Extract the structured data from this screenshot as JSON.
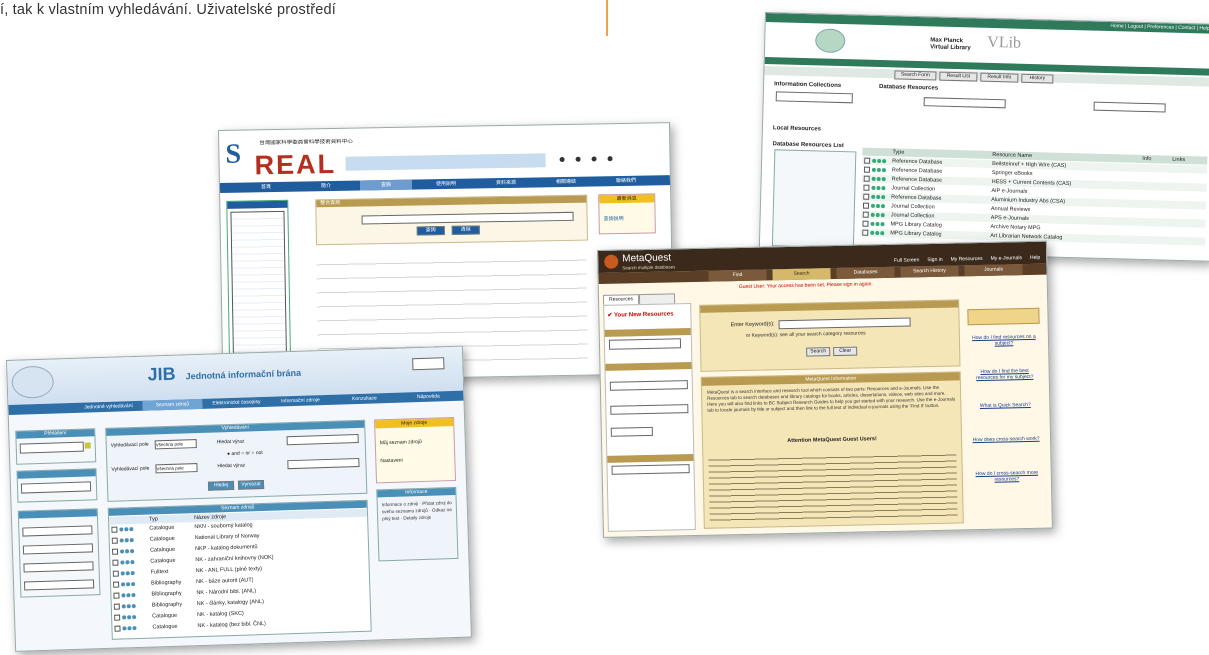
{
  "intro_text": "í, tak k vlastním vyhledávání. Uživatelské prostředí",
  "colors": {
    "accent_line": "#f0a050",
    "vlib_green": "#2e7a5a",
    "real_blue": "#1f5d9e",
    "metaquest_dark": "#3b2a1c",
    "metaquest_tan": "#f5e6b8",
    "jib_blue": "#2f6fa8"
  },
  "vlib": {
    "brand": "Max Planck Virtual Library",
    "logo_text": "VLib",
    "top_links": "Home | Logout | Preferences | Contact | Help",
    "search_tabs": [
      "Search Form",
      "Result List",
      "Result Info",
      "History"
    ],
    "sections": [
      "Information Collections",
      "Database Resources",
      "Local Resources",
      "Database Resources List"
    ],
    "list_header": [
      "Type",
      "Resource Name",
      "Info",
      "Links"
    ],
    "types": [
      "Reference Database",
      "Reference Database",
      "Reference Database",
      "Journal Collection",
      "Reference Database",
      "Journal Collection",
      "Journal Collection",
      "MPG Library Catalog",
      "MPG Library Catalog"
    ],
    "names": [
      "Beilsteinref + High Wire (CAS)",
      "Springer eBooks",
      "HESS + Current Contents (CAS)",
      "AIP e-Journals",
      "Aluminium Industry Abs (CSA)",
      "Annual Reviews",
      "APS e-Journals",
      "Archive Notary MPG",
      "Art Librarian Network Catalog"
    ]
  },
  "real": {
    "logo_text": "REAL",
    "logo_mark": "S",
    "logo_subtitle": "台灣國家科學委員會科學技術資料中心",
    "nav": [
      "首頁",
      "簡介",
      "查詢",
      "使用說明",
      "資料來源",
      "相關連結",
      "聯絡我們"
    ],
    "search_box_title": "整合查詢",
    "buttons": [
      "查詢",
      "清除"
    ],
    "right_box": "最新消息",
    "right_link": "查詢說明"
  },
  "metaquest": {
    "logo_text": "MetaQuest",
    "logo_sub": "Search multiple databases",
    "top_links": [
      "Full Screen",
      "Sign in",
      "My Resources",
      "My e-Journals",
      "Help"
    ],
    "tabs": [
      "Find",
      "Search",
      "Databases",
      "Search History",
      "Journals"
    ],
    "warning": "Guest User: Your access has been set, Please sign in again.",
    "left_tab": "Resources",
    "left_title": "Your New Resources",
    "search_label": "Enter Keyword(s):",
    "search_hint": "or Keyword(s): see all your search category resources",
    "buttons": [
      "Search",
      "Clear"
    ],
    "section_title": "MetaQuest Information",
    "body_heading": "Attention MetaQuest Guest Users!",
    "body_text": "MetaQuest is a search interface and research tool which consists of two parts: Resources and e-Journals. Use the Resources tab to search databases and library catalogs for books, articles, dissertations, videos, web sites and more. Here you will also find links to BC Subject Research Guides to help you get started with your research. Use the e-Journals tab to locate journals by title or subject and then link to the full text of individual e-journals using the 'Find It' button.",
    "right_help": [
      "How do I find resources on a subject?",
      "How do I find the best resources for my subject?",
      "What is Quick Search?",
      "How does cross-search work?",
      "How do I cross-search more resources?"
    ]
  },
  "jib": {
    "logo_text": "JIB",
    "title": "Jednotná informační brána",
    "nav": [
      "Jednotné vyhledávání",
      "Seznam zdrojů",
      "Elektronické časopisy",
      "Informační zdroje",
      "Konzultace",
      "Nápověda"
    ],
    "login_box": "Přihlášení",
    "search_box_title": "Vyhledávání",
    "field_labels": [
      "Vyhledávací pole",
      "Hledat výraz",
      "Hledat výraz"
    ],
    "field_values": [
      "Všechna pole",
      "Všechna pole"
    ],
    "boolean": "● and  ○ or  ○ not",
    "buttons": [
      "Hledej",
      "Vymazat"
    ],
    "right_box_title": "Moje zdroje",
    "right_box_items": [
      "Můj seznam zdrojů",
      "Nastavení"
    ],
    "list_title": "Seznam zdrojů",
    "list_header": [
      "Typ",
      "Název zdroje"
    ],
    "types": [
      "Catalogue",
      "Catalogue",
      "Catalogue",
      "Catalogue",
      "Fulltext",
      "Bibliography",
      "Bibliography",
      "Bibliography",
      "Catalogue",
      "Catalogue"
    ],
    "names": [
      "NKN - souborný katalog",
      "National Library of Norway",
      "NKP - katalog dokumentů",
      "NK - zahraniční knihovny (NOK)",
      "NK - ANL FULL (plné texty)",
      "NK - báze autorit (AUT)",
      "NK - Národní bibl. (ANL)",
      "NK - články, katalogy (ANL)",
      "NK - katalog (SKC)",
      "NK - katalog (bez bibl. ČNL)"
    ],
    "right_box2_title": "Informace",
    "right_box2_text": "Informace o zdroji · Přidat zdroj do svého seznamu zdrojů · Odkaz na plný text · Detaily zdroje"
  }
}
